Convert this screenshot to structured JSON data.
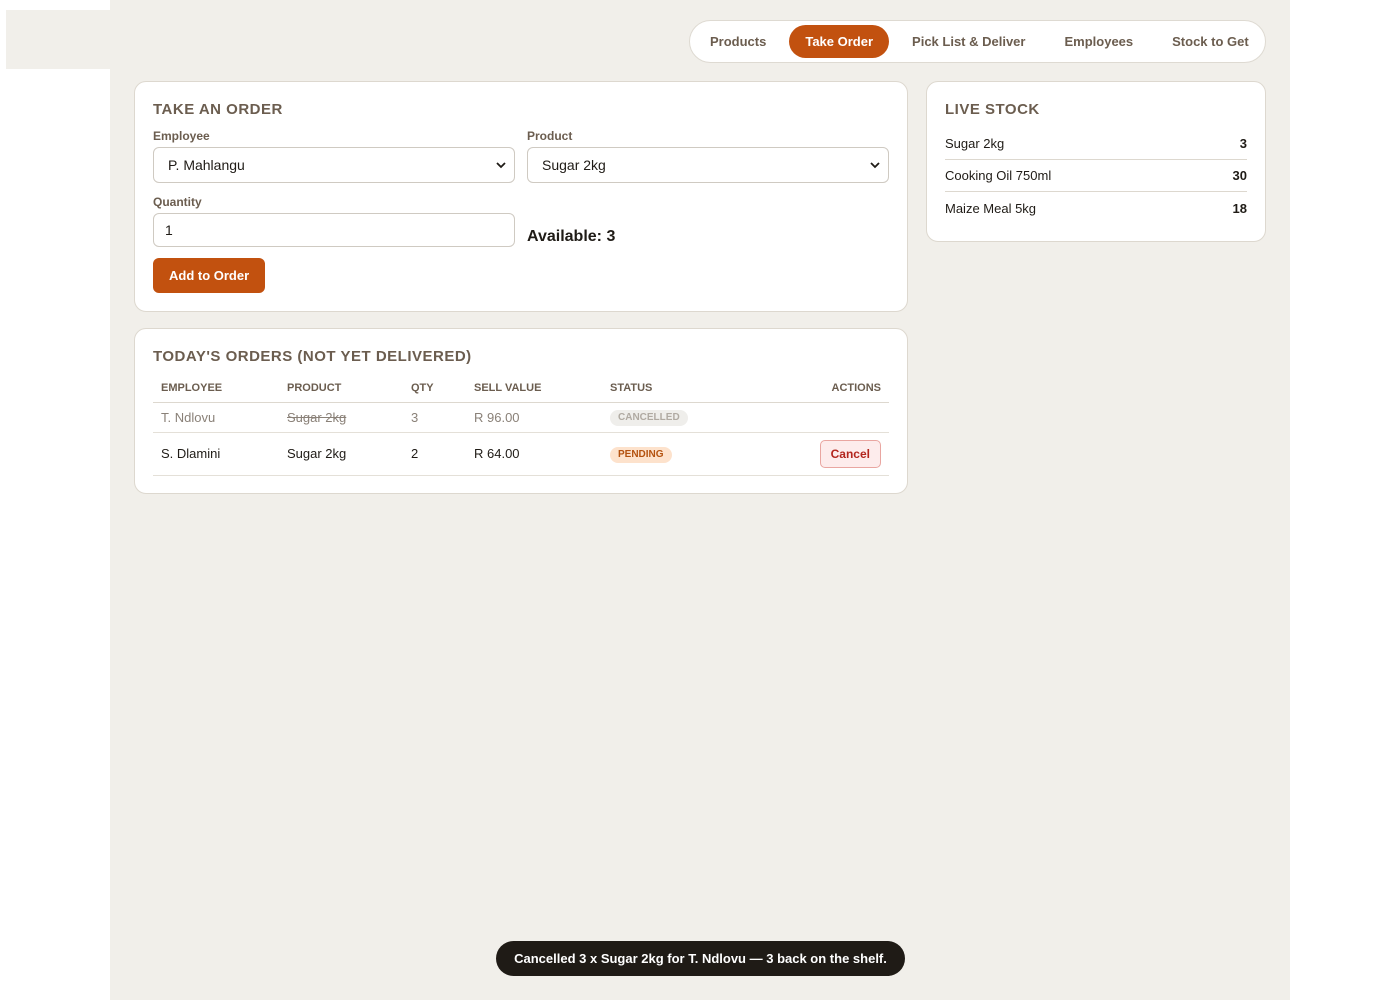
{
  "nav": {
    "items": [
      {
        "label": "Products"
      },
      {
        "label": "Take Order"
      },
      {
        "label": "Pick List & Deliver"
      },
      {
        "label": "Employees"
      },
      {
        "label": "Stock to Get"
      }
    ],
    "active": "Take Order"
  },
  "take_order": {
    "title": "TAKE AN ORDER",
    "employee_label": "Employee",
    "employee_value": "P. Mahlangu",
    "product_label": "Product",
    "product_value": "Sugar 2kg",
    "quantity_label": "Quantity",
    "quantity_value": "1",
    "available_text": "Available: 3",
    "add_button": "Add to Order"
  },
  "orders": {
    "title": "TODAY'S ORDERS (NOT YET DELIVERED)",
    "columns": [
      "EMPLOYEE",
      "PRODUCT",
      "QTY",
      "SELL VALUE",
      "STATUS",
      "ACTIONS"
    ],
    "rows": [
      {
        "employee": "T. Ndlovu",
        "product": "Sugar 2kg",
        "qty": "3",
        "sell_value": "R 96.00",
        "status": "CANCELLED",
        "action": ""
      },
      {
        "employee": "S. Dlamini",
        "product": "Sugar 2kg",
        "qty": "2",
        "sell_value": "R 64.00",
        "status": "PENDING",
        "action": "Cancel"
      }
    ]
  },
  "live_stock": {
    "title": "LIVE STOCK",
    "items": [
      {
        "name": "Sugar 2kg",
        "qty": "3"
      },
      {
        "name": "Cooking Oil 750ml",
        "qty": "30"
      },
      {
        "name": "Maize Meal 5kg",
        "qty": "18"
      }
    ]
  },
  "toast": {
    "message": "Cancelled 3 x Sugar 2kg for T. Ndlovu — 3 back on the shelf."
  },
  "colors": {
    "accent": "#c2510f",
    "background": "#f1efea",
    "cancel_red": "#b3261e"
  }
}
